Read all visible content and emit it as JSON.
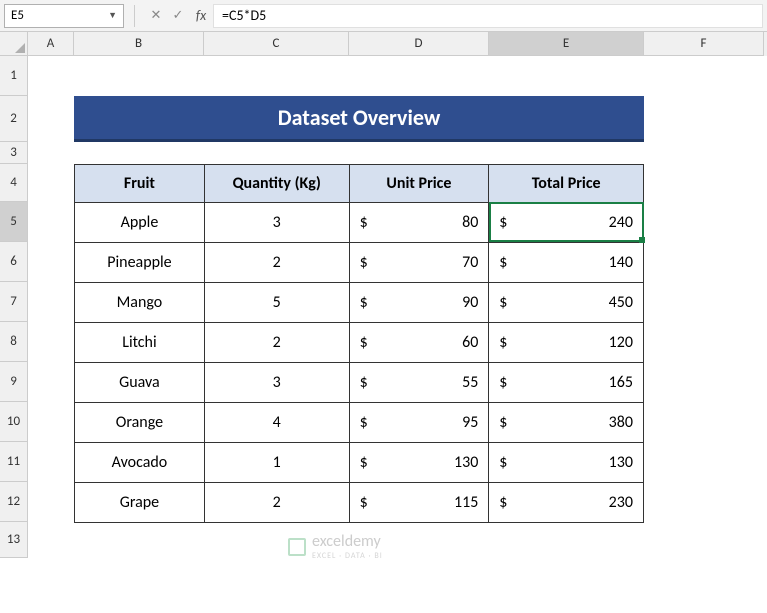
{
  "name_box": "E5",
  "formula": "=C5*D5",
  "columns": [
    "A",
    "B",
    "C",
    "D",
    "E",
    "F"
  ],
  "active_column": "E",
  "active_row": "5",
  "rows": [
    "1",
    "2",
    "3",
    "4",
    "5",
    "6",
    "7",
    "8",
    "9",
    "10",
    "11",
    "12",
    "13"
  ],
  "title": "Dataset Overview",
  "headers": {
    "fruit": "Fruit",
    "qty": "Quantity (Kg)",
    "unit": "Unit Price",
    "total": "Total Price"
  },
  "currency": "$",
  "data": [
    {
      "fruit": "Apple",
      "qty": "3",
      "unit": "80",
      "total": "240"
    },
    {
      "fruit": "Pineapple",
      "qty": "2",
      "unit": "70",
      "total": "140"
    },
    {
      "fruit": "Mango",
      "qty": "5",
      "unit": "90",
      "total": "450"
    },
    {
      "fruit": "Litchi",
      "qty": "2",
      "unit": "60",
      "total": "120"
    },
    {
      "fruit": "Guava",
      "qty": "3",
      "unit": "55",
      "total": "165"
    },
    {
      "fruit": "Orange",
      "qty": "4",
      "unit": "95",
      "total": "380"
    },
    {
      "fruit": "Avocado",
      "qty": "1",
      "unit": "130",
      "total": "130"
    },
    {
      "fruit": "Grape",
      "qty": "2",
      "unit": "115",
      "total": "230"
    }
  ],
  "watermark": {
    "brand": "exceldemy",
    "tag": "EXCEL · DATA · BI"
  },
  "chart_data": {
    "type": "table",
    "title": "Dataset Overview",
    "columns": [
      "Fruit",
      "Quantity (Kg)",
      "Unit Price",
      "Total Price"
    ],
    "rows": [
      [
        "Apple",
        3,
        80,
        240
      ],
      [
        "Pineapple",
        2,
        70,
        140
      ],
      [
        "Mango",
        5,
        90,
        450
      ],
      [
        "Litchi",
        2,
        60,
        120
      ],
      [
        "Guava",
        3,
        55,
        165
      ],
      [
        "Orange",
        4,
        95,
        380
      ],
      [
        "Avocado",
        1,
        130,
        130
      ],
      [
        "Grape",
        2,
        115,
        230
      ]
    ]
  }
}
